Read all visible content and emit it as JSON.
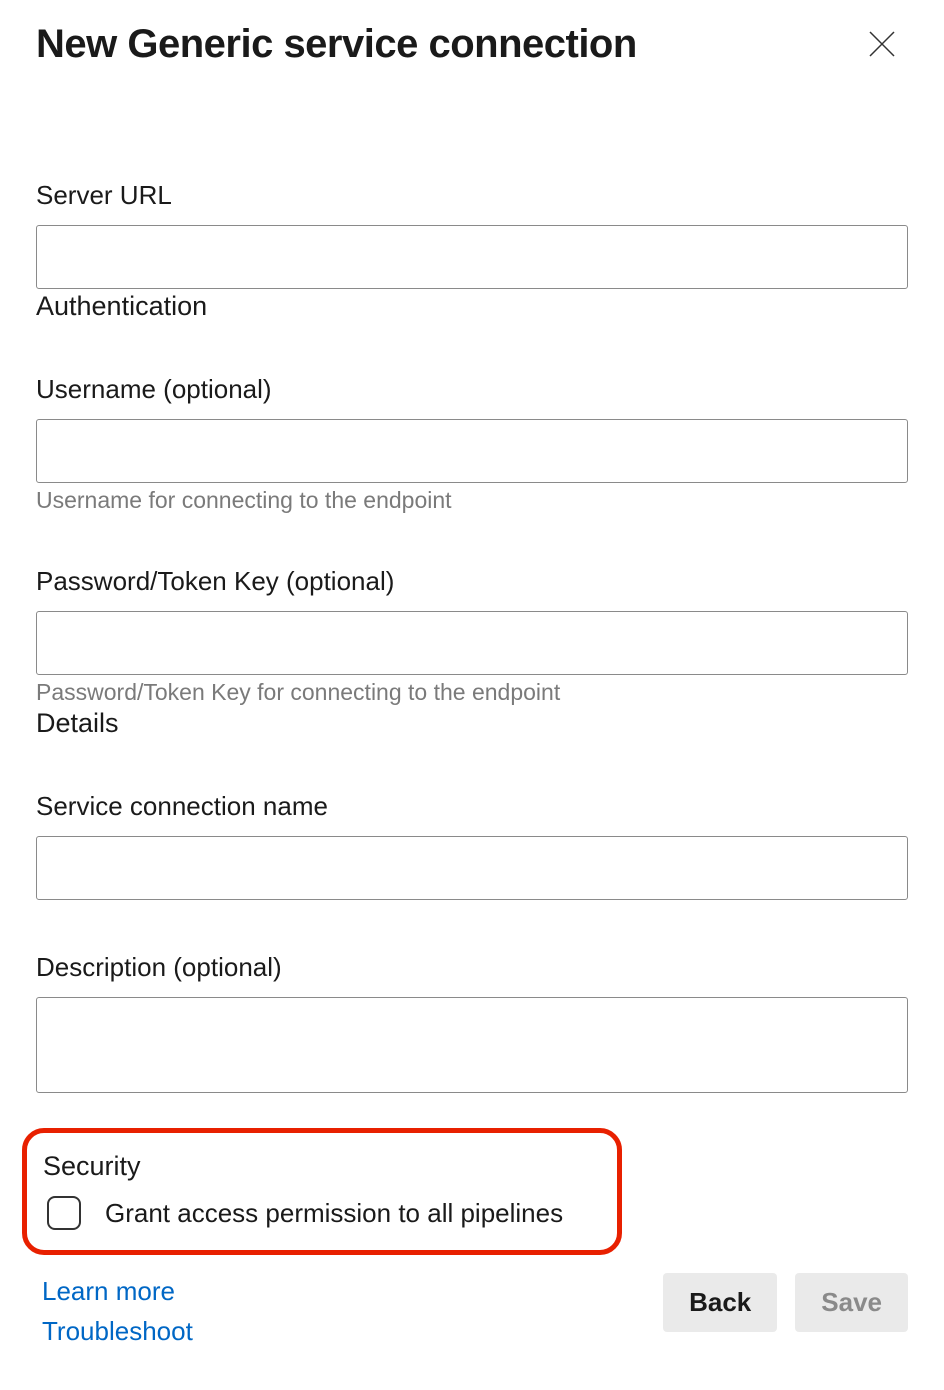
{
  "dialog": {
    "title": "New Generic service connection"
  },
  "fields": {
    "server_url": {
      "label": "Server URL",
      "value": ""
    },
    "authentication_section": "Authentication",
    "username": {
      "label": "Username (optional)",
      "value": "",
      "help": "Username for connecting to the endpoint"
    },
    "password": {
      "label": "Password/Token Key (optional)",
      "value": "",
      "help": "Password/Token Key for connecting to the endpoint"
    },
    "details_section": "Details",
    "connection_name": {
      "label": "Service connection name",
      "value": ""
    },
    "description": {
      "label": "Description (optional)",
      "value": ""
    },
    "security_section": "Security",
    "grant_access": {
      "label": "Grant access permission to all pipelines",
      "checked": false
    }
  },
  "footer": {
    "learn_more": "Learn more",
    "troubleshoot": "Troubleshoot",
    "back": "Back",
    "save": "Save"
  }
}
